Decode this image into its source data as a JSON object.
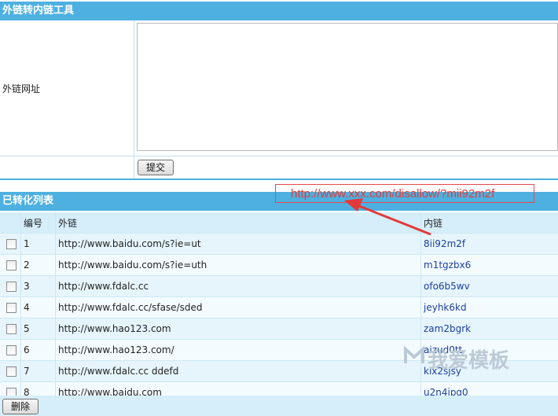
{
  "tool_header": {
    "title": "外链转内链工具"
  },
  "form": {
    "label": "外链网址",
    "textarea_value": "",
    "submit_label": "提交"
  },
  "list_header": {
    "title": "已转化列表"
  },
  "table": {
    "headers": {
      "num": "编号",
      "external": "外链",
      "internal": "内链"
    },
    "rows": [
      {
        "num": "1",
        "external": "http://www.baidu.com/s?ie=ut",
        "internal": "8ii92m2f"
      },
      {
        "num": "2",
        "external": "http://www.baidu.com/s?ie=uth",
        "internal": "m1tgzbx6"
      },
      {
        "num": "3",
        "external": "http://www.fdalc.cc",
        "internal": "ofo6b5wv"
      },
      {
        "num": "4",
        "external": "http://www.fdalc.cc/sfase/sded",
        "internal": "jeyhk6kd"
      },
      {
        "num": "5",
        "external": "http://www.hao123.com",
        "internal": "zam2bgrk"
      },
      {
        "num": "6",
        "external": "http://www.hao123.com/",
        "internal": "aizud0tt"
      },
      {
        "num": "7",
        "external": "http://www.fdalc.cc ddefd",
        "internal": "kix2sjsy"
      },
      {
        "num": "8",
        "external": "http://www.baidu.com",
        "internal": "u2n4jpg0"
      }
    ]
  },
  "delete_label": "删除",
  "annotation": {
    "text": "http://www.xxx.com/disallow/?mii92m2f",
    "color": "#e23a3a"
  },
  "watermark": {
    "text": "我爱模板"
  },
  "colors": {
    "header_bg": "#4db0e0",
    "row_bg": "#e6f5fc",
    "link": "#1a3fa0"
  }
}
